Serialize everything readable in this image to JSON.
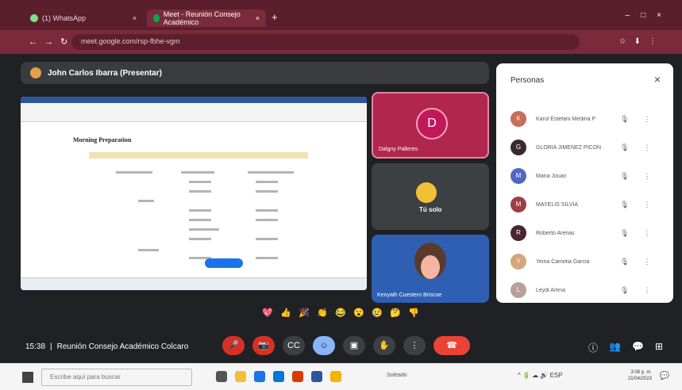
{
  "browser": {
    "tabs": [
      {
        "label": "(1) WhatsApp"
      },
      {
        "label": "Meet - Reunión Consejo Académico"
      }
    ],
    "url": "meet.google.com/rsp-fbhe-vgm",
    "new_tab": "+"
  },
  "presenter": {
    "name": "John Carlos Ibarra (Presentar)"
  },
  "shared_doc": {
    "heading": "Morning Preparation",
    "present_button": "Dejar de presentar"
  },
  "tiles": {
    "dalam": {
      "initial": "D",
      "name": "Dalgny Palleres"
    },
    "me": {
      "name": "Tú solo"
    },
    "kenyath": {
      "name": "Kenyath Cuestero Briscoe"
    }
  },
  "people_panel": {
    "title": "Personas",
    "close": "×",
    "people": [
      {
        "name": "Karol Estefani Medina P",
        "initial": "K",
        "color": "#c76d5a"
      },
      {
        "name": "GLORIA JIMENEZ PICON",
        "initial": "G",
        "color": "#3b2a2d"
      },
      {
        "name": "Maria Jouan",
        "initial": "M",
        "color": "#5167c6"
      },
      {
        "name": "MAYELIS SILVIA",
        "initial": "M",
        "color": "#9b3f46"
      },
      {
        "name": "Roberto Arenas",
        "initial": "R",
        "color": "#4a2530"
      },
      {
        "name": "Yeina Camelia Garcia",
        "initial": "Y",
        "color": "#d5a67c"
      },
      {
        "name": "Leydi Arena",
        "initial": "L",
        "color": "#b9a09b"
      }
    ]
  },
  "reactions": [
    "💖",
    "👍",
    "🎉",
    "👏",
    "😂",
    "😮",
    "😢",
    "🤔",
    "👎"
  ],
  "meeting": {
    "time": "15:38",
    "separator": "|",
    "title": "Reunión Consejo Académico Colcaro"
  },
  "controls": {
    "mic": "🎤",
    "camera": "📷",
    "captions": "CC",
    "emoji": "☺",
    "present": "▣",
    "hand": "✋",
    "more": "⋮",
    "hangup": "☎"
  },
  "right_controls": [
    "ⓘ",
    "👥",
    "💬",
    "⊞"
  ],
  "taskbar": {
    "search_placeholder": "Escribe aquí para buscar",
    "weather": "Soleado",
    "time": "3:08 p. m.",
    "date": "21/04/2023"
  }
}
